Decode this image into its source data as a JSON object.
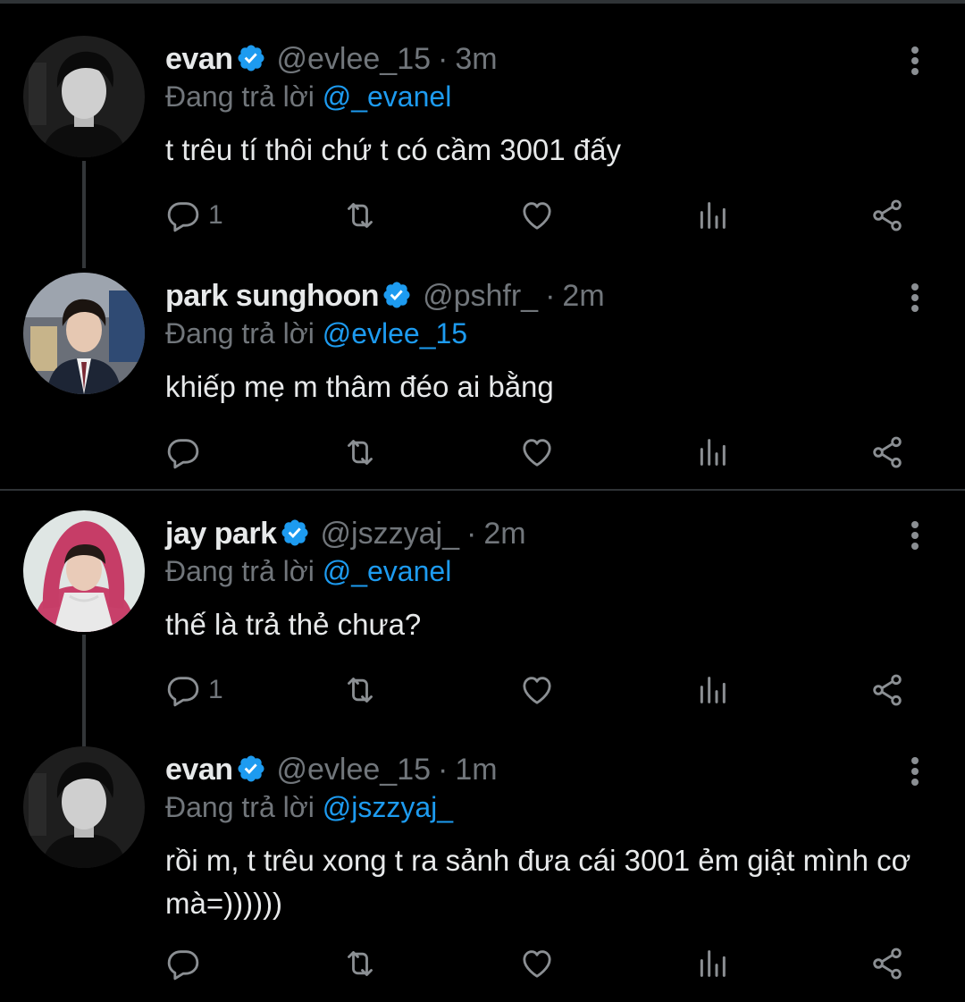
{
  "tweets": [
    {
      "name": "evan",
      "handle": "@evlee_15",
      "time": "3m",
      "replying_prefix": "Đang trả lời",
      "replying_to": "@_evanel",
      "text": "t trêu tí thôi chứ t có cầm 3001 đấy",
      "reply_count": "1",
      "avatar_style": "bw"
    },
    {
      "name": "park sunghoon",
      "handle": "@pshfr_",
      "time": "2m",
      "replying_prefix": "Đang trả lời",
      "replying_to": "@evlee_15",
      "text": "khiếp mẹ m thâm đéo ai bằng",
      "reply_count": "",
      "avatar_style": "suit"
    },
    {
      "name": "jay park",
      "handle": "@jszzyaj_",
      "time": "2m",
      "replying_prefix": "Đang trả lời",
      "replying_to": "@_evanel",
      "text": "thế là trả thẻ chưa?",
      "reply_count": "1",
      "avatar_style": "pink"
    },
    {
      "name": "evan",
      "handle": "@evlee_15",
      "time": "1m",
      "replying_prefix": "Đang trả lời",
      "replying_to": "@jszzyaj_",
      "text": "rồi m, t trêu xong t ra sảnh đưa cái 3001 ẻm giật mình cơ mà=))))))",
      "reply_count": "",
      "avatar_style": "bw"
    }
  ],
  "colors": {
    "background": "#000000",
    "text": "#e7e9ea",
    "muted": "#71767b",
    "accent": "#1d9bf0",
    "separator": "#2f3336"
  },
  "icons": [
    "verified-badge-icon",
    "more-options-icon",
    "reply-icon",
    "retweet-icon",
    "like-icon",
    "views-icon",
    "share-icon"
  ]
}
